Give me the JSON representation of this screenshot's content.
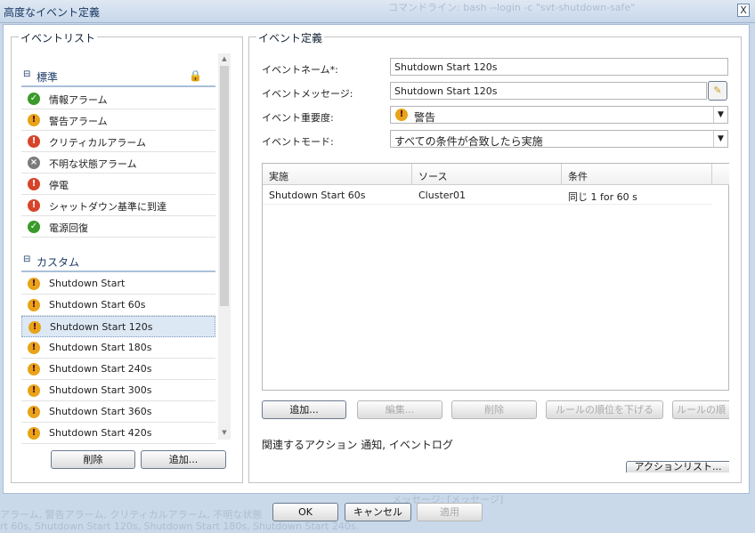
{
  "window": {
    "title": "高度なイベント定義",
    "close": "X"
  },
  "background": {
    "line1": "コマンドライン: bash --login -c \"svt-shutdown-safe\"",
    "line2": "メッセージ: [メッセージ]",
    "line3": "アラーム, 警告アラーム, クリティカルアラーム, 不明な状態",
    "line4": "rt 60s, Shutdown Start 120s, Shutdown Start 180s, Shutdown Start 240s."
  },
  "event_list": {
    "legend": "イベントリスト",
    "standard": {
      "title": "標準",
      "items": [
        {
          "label": "情報アラーム",
          "icon": "check-icon"
        },
        {
          "label": "警告アラーム",
          "icon": "warning-icon"
        },
        {
          "label": "クリティカルアラーム",
          "icon": "critical-icon"
        },
        {
          "label": "不明な状態アラーム",
          "icon": "unknown-icon"
        },
        {
          "label": "停電",
          "icon": "critical-icon"
        },
        {
          "label": "シャットダウン基準に到達",
          "icon": "critical-icon"
        },
        {
          "label": "電源回復",
          "icon": "check-icon"
        }
      ]
    },
    "custom": {
      "title": "カスタム",
      "selected": "Shutdown Start 120s",
      "items": [
        "Shutdown Start",
        "Shutdown Start 60s",
        "Shutdown Start 120s",
        "Shutdown Start 180s",
        "Shutdown Start 240s",
        "Shutdown Start 300s",
        "Shutdown Start 360s",
        "Shutdown Start 420s"
      ]
    },
    "delete": "削除",
    "add": "追加..."
  },
  "definition": {
    "legend": "イベント定義",
    "name_label": "イベントネーム*:",
    "name_value": "Shutdown Start 120s",
    "message_label": "イベントメッセージ:",
    "message_value": "Shutdown Start 120s",
    "severity_label": "イベント重要度:",
    "severity_value": "警告",
    "mode_label": "イベントモード:",
    "mode_value": "すべての条件が合致したら実施",
    "columns": [
      "実施",
      "ソース",
      "条件"
    ],
    "rows": [
      [
        "Shutdown Start 60s",
        "Cluster01",
        "同じ 1 for 60 s"
      ]
    ],
    "buttons": {
      "add": "追加...",
      "edit": "編集...",
      "delete": "削除",
      "down": "ルールの順位を下げる",
      "up": "ルールの順"
    },
    "related_actions": "関連するアクション 通知, イベントログ",
    "action_list": "アクションリスト..."
  },
  "footer": {
    "ok": "OK",
    "cancel": "キャンセル",
    "apply": "適用"
  }
}
